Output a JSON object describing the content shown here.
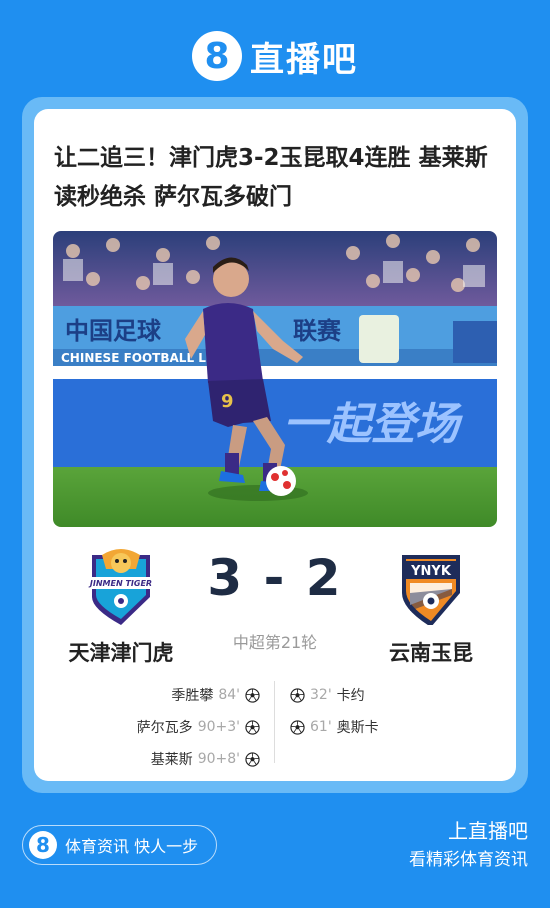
{
  "brand": {
    "badge": "8",
    "name": "直播吧"
  },
  "article": {
    "headline": "让二追三！津门虎3-2玉昆取4连胜 基莱斯读秒绝杀 萨尔瓦多破门",
    "photo": {
      "banner_text": "中国足球",
      "banner_text_right": "联赛",
      "banner_en": "CHINESE FOOTBALL LEAGUE",
      "board_text": "一起登场",
      "jersey_number": "9"
    }
  },
  "match": {
    "home": {
      "name": "天津津门虎",
      "logo_text": "JINMEN TIGER",
      "score": "3"
    },
    "away": {
      "name": "云南玉昆",
      "logo_text": "YNYK",
      "score": "2"
    },
    "score_display": "3 - 2",
    "round": "中超第21轮",
    "home_scorers": [
      {
        "player": "季胜攀",
        "minute": "84'"
      },
      {
        "player": "萨尔瓦多",
        "minute": "90+3'"
      },
      {
        "player": "基莱斯",
        "minute": "90+8'"
      }
    ],
    "away_scorers": [
      {
        "player": "卡约",
        "minute": "32'"
      },
      {
        "player": "奥斯卡",
        "minute": "61'"
      }
    ]
  },
  "footer": {
    "badge": "8",
    "slogan": "体育资讯 快人一步",
    "line1": "上直播吧",
    "line2": "看精彩体育资讯"
  },
  "colors": {
    "brand_blue": "#1f8ff0",
    "score_navy": "#1e2c44",
    "home_purple": "#3b2a86",
    "away_orange": "#f08a24"
  },
  "icons": {
    "goal": "soccer-ball-icon"
  }
}
